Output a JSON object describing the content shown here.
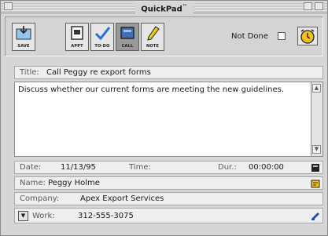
{
  "window": {
    "title": "QuickPad",
    "title_mark": "™"
  },
  "toolbar": {
    "buttons": [
      {
        "id": "save",
        "label": "SAVE"
      },
      {
        "id": "appt",
        "label": "APPT"
      },
      {
        "id": "todo",
        "label": "TO-DO"
      },
      {
        "id": "call",
        "label": "CALL"
      },
      {
        "id": "note",
        "label": "NOTE"
      }
    ],
    "not_done_label": "Not Done"
  },
  "form": {
    "title_label": "Title:",
    "title_value": "Call Peggy re export forms",
    "notes": "Discuss whether our current forms are meeting the new guidelines.",
    "date_label": "Date:",
    "date_value": "11/13/95",
    "time_label": "Time:",
    "time_value": "",
    "dur_label": "Dur.:",
    "dur_value": "00:00:00",
    "name_label": "Name:",
    "name_value": "Peggy Holme",
    "company_label": "Company:",
    "company_value": "Apex Export Services",
    "phone_label": "Work:",
    "phone_value": "312-555-3075"
  }
}
